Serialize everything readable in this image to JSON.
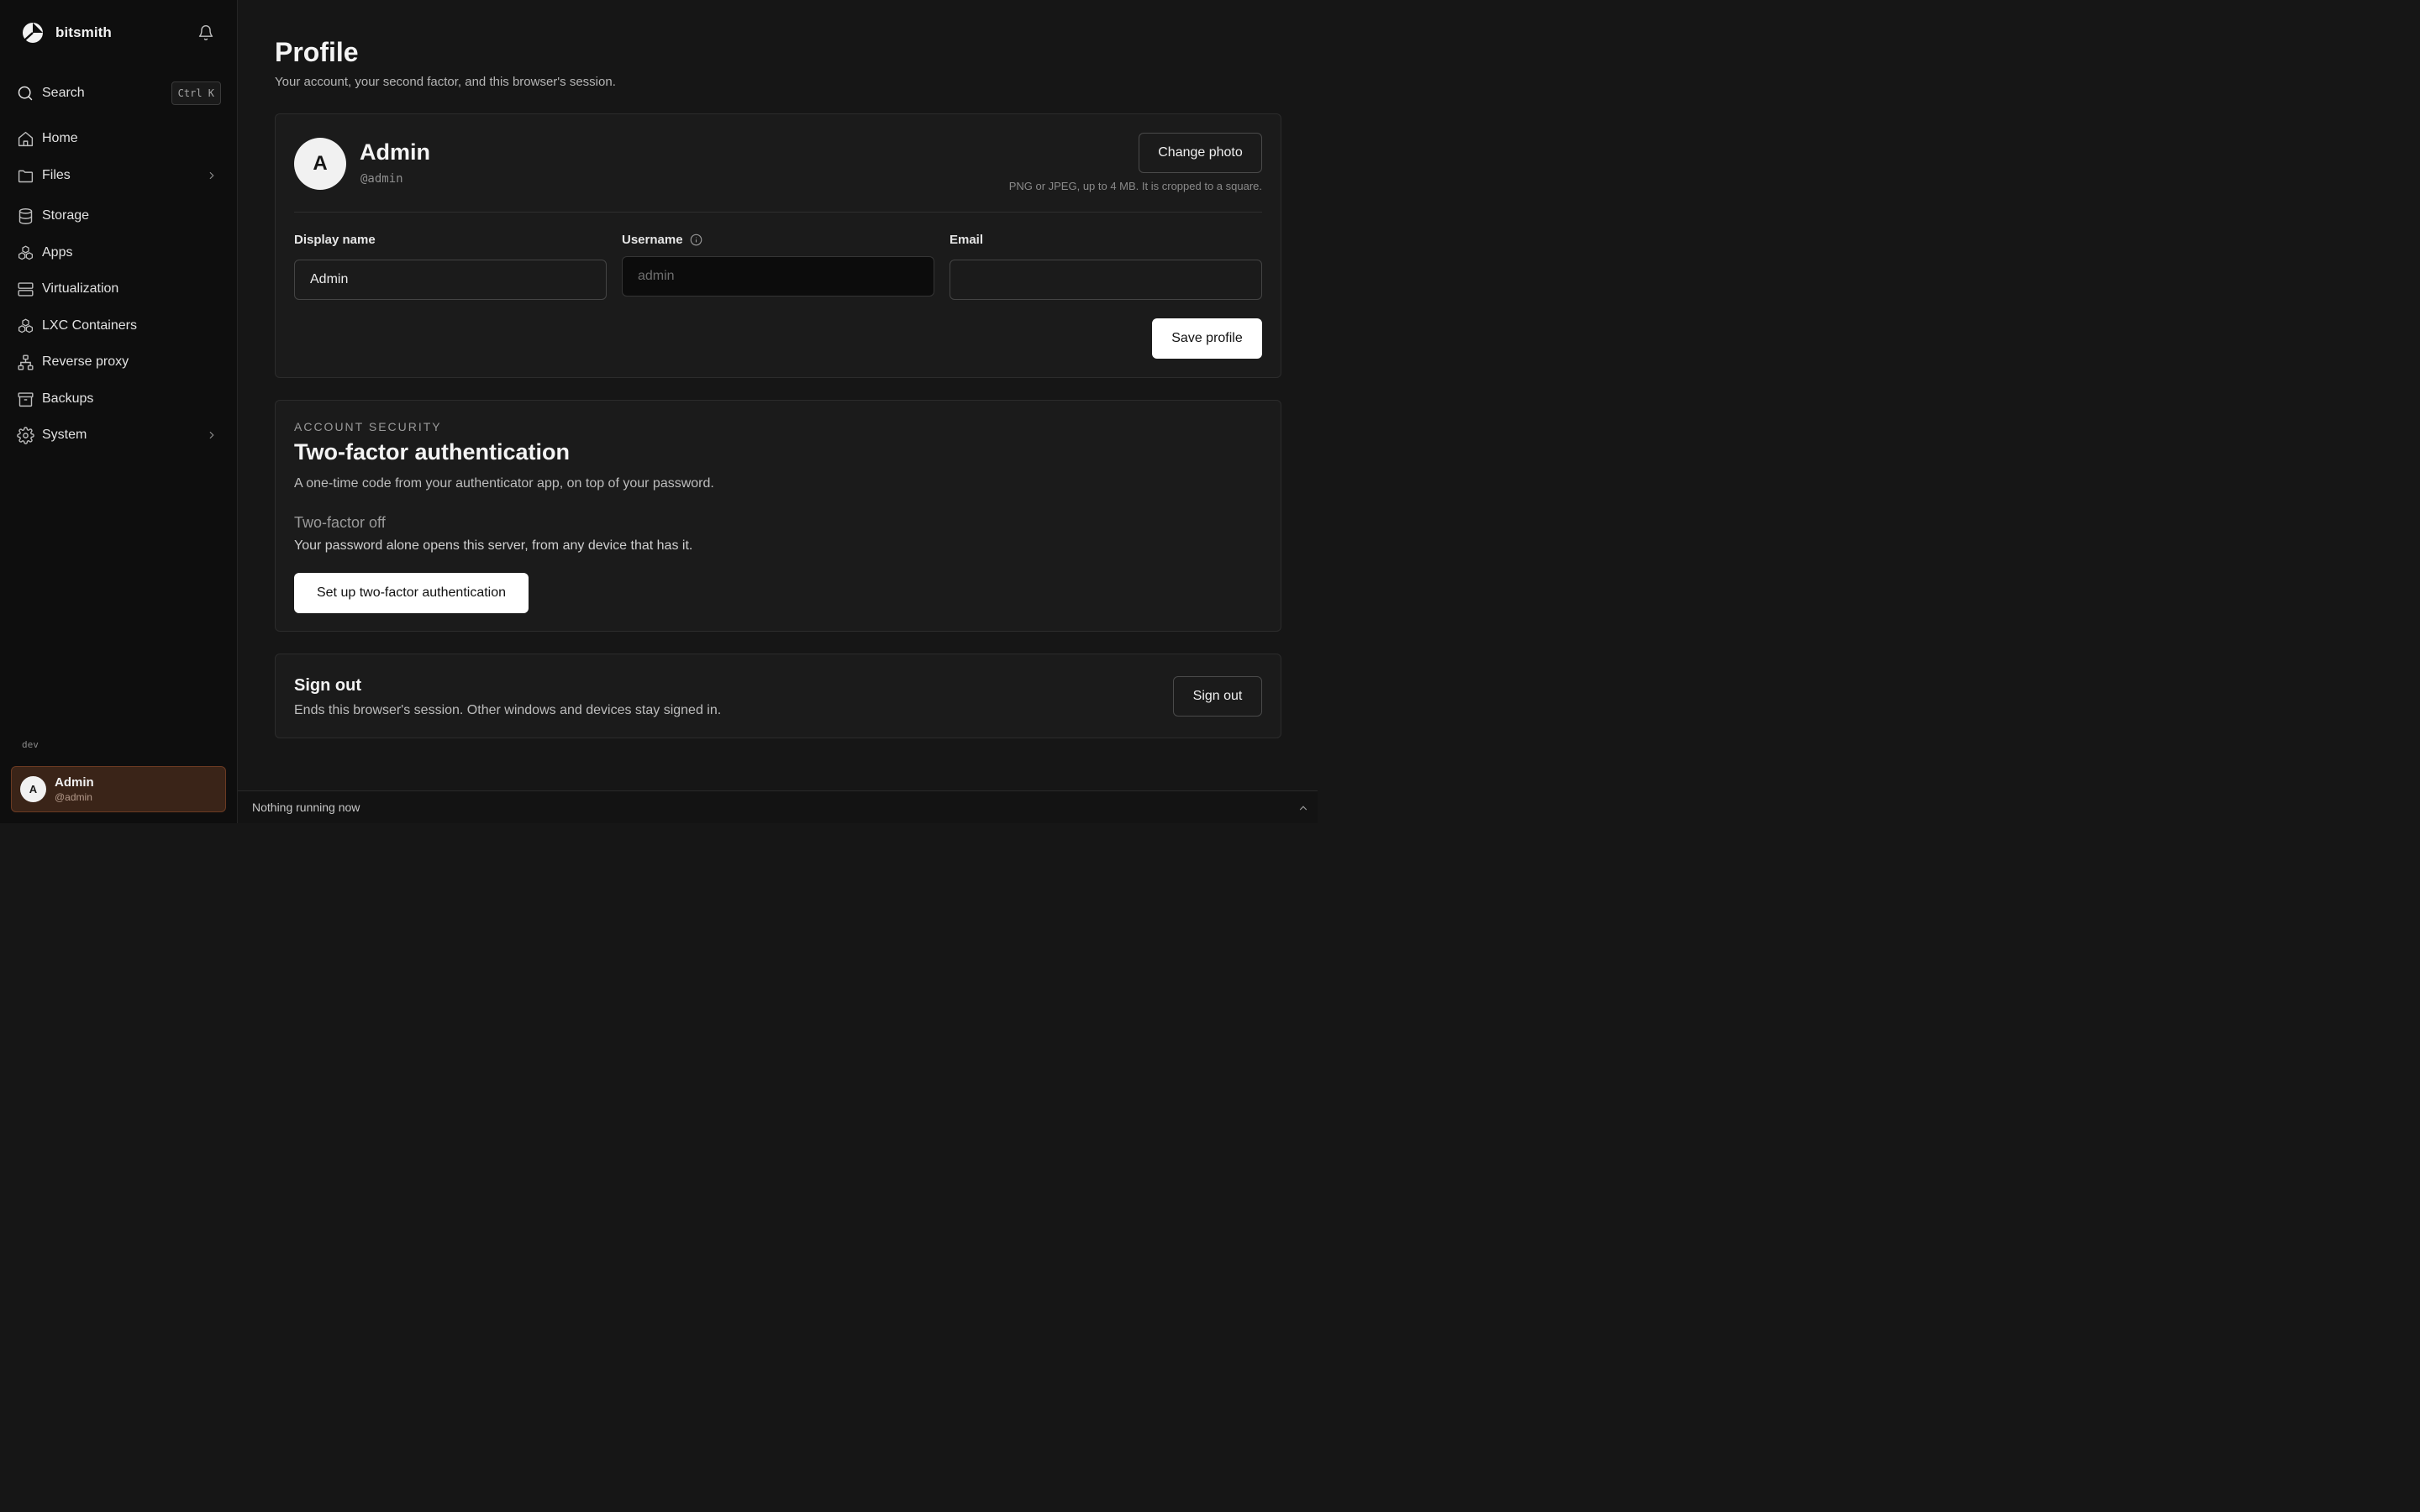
{
  "sidebar": {
    "brand": "bitsmith",
    "search_label": "Search",
    "search_shortcut": "Ctrl K",
    "items": [
      {
        "label": "Home",
        "icon": "home-icon"
      },
      {
        "label": "Files",
        "icon": "folder-icon"
      },
      {
        "label": "Storage",
        "icon": "database-icon"
      },
      {
        "label": "Apps",
        "icon": "apps-icon"
      },
      {
        "label": "Virtualization",
        "icon": "server-icon"
      },
      {
        "label": "LXC Containers",
        "icon": "containers-icon"
      },
      {
        "label": "Reverse proxy",
        "icon": "network-icon"
      },
      {
        "label": "Backups",
        "icon": "archive-icon"
      },
      {
        "label": "System",
        "icon": "gear-icon"
      }
    ],
    "env": "dev",
    "user": {
      "initial": "A",
      "name": "Admin",
      "handle": "@admin"
    }
  },
  "page": {
    "title": "Profile",
    "subtitle": "Your account, your second factor, and this browser's session."
  },
  "profile": {
    "initial": "A",
    "name": "Admin",
    "handle": "@admin",
    "change_photo": "Change photo",
    "photo_hint": "PNG or JPEG, up to 4 MB. It is cropped to a square.",
    "display_name_label": "Display name",
    "display_name_value": "Admin",
    "username_label": "Username",
    "username_placeholder": "admin",
    "email_label": "Email",
    "email_value": "",
    "save_label": "Save profile"
  },
  "security": {
    "eyebrow": "ACCOUNT SECURITY",
    "title": "Two-factor authentication",
    "description": "A one-time code from your authenticator app, on top of your password.",
    "status": "Two-factor off",
    "status_description": "Your password alone opens this server, from any device that has it.",
    "setup_label": "Set up two-factor authentication"
  },
  "signout": {
    "title": "Sign out",
    "description": "Ends this browser's session. Other windows and devices stay signed in.",
    "button": "Sign out"
  },
  "statusbar": {
    "text": "Nothing running now"
  },
  "colors": {
    "background": "#161616",
    "sidebar": "#0e0e0e",
    "card": "#1b1b1b",
    "user_card": "#3a2418",
    "user_card_border": "#6b3a22"
  }
}
